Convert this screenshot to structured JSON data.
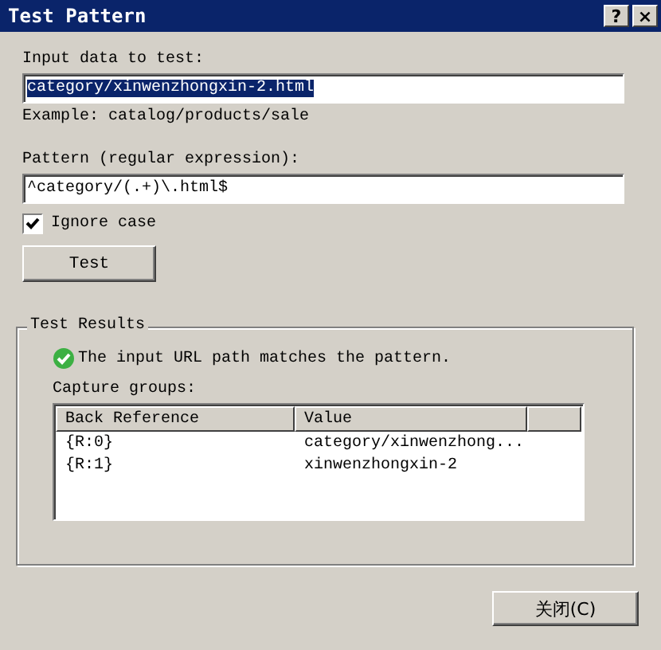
{
  "window": {
    "title": "Test Pattern",
    "controls": [
      "?",
      "×"
    ]
  },
  "input": {
    "label": "Input data to test:",
    "value": "category/xinwenzhongxin-2.html",
    "selected": true
  },
  "example": "Example: catalog/products/sale",
  "pattern": {
    "label": "Pattern (regular expression):",
    "value": "^category/(.+)\\.html$"
  },
  "ignore_case": {
    "label": "Ignore case",
    "checked": true
  },
  "test_button": "Test",
  "results": {
    "title": "Test Results",
    "message": "The input URL path matches the pattern.",
    "groups_label": "Capture groups:",
    "columns": [
      "Back Reference",
      "Value"
    ],
    "rows": [
      {
        "cells": [
          "{R:0}",
          "category/xinwenzhong..."
        ]
      },
      {
        "cells": [
          "{R:1}",
          "xinwenzhongxin-2"
        ]
      }
    ]
  },
  "close_button": "关闭(C)"
}
